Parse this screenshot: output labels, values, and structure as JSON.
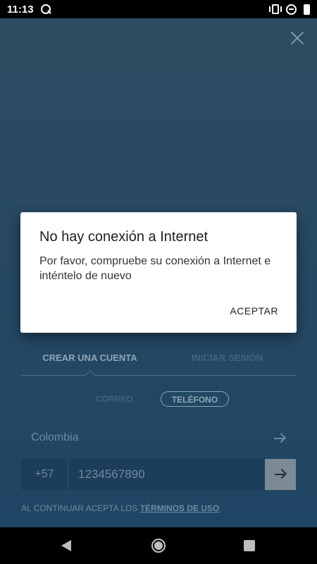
{
  "status_bar": {
    "time": "11:13"
  },
  "app": {
    "tabs": [
      {
        "label": "CREAR UNA CUENTA",
        "active": true
      },
      {
        "label": "INICIAR SESIÓN",
        "active": false
      }
    ],
    "method_toggle": {
      "email_label": "CORREO",
      "phone_label": "TELÉFONO",
      "selected": "TELÉFONO"
    },
    "country": {
      "value": "Colombia"
    },
    "phone": {
      "code": "+57",
      "placeholder": "1234567890"
    },
    "terms": {
      "prefix": "AL CONTINUAR ACEPTA LOS ",
      "link": "TÉRMINOS DE USO",
      "suffix": "."
    }
  },
  "dialog": {
    "title": "No hay conexión a Internet",
    "message": "Por favor, compruebe su conexión a Internet e inténtelo de nuevo",
    "ok_label": "ACEPTAR"
  },
  "colors": {
    "background_top": "#2e4c61",
    "background_bottom": "#1f4564",
    "dialog": "#ffffff"
  }
}
